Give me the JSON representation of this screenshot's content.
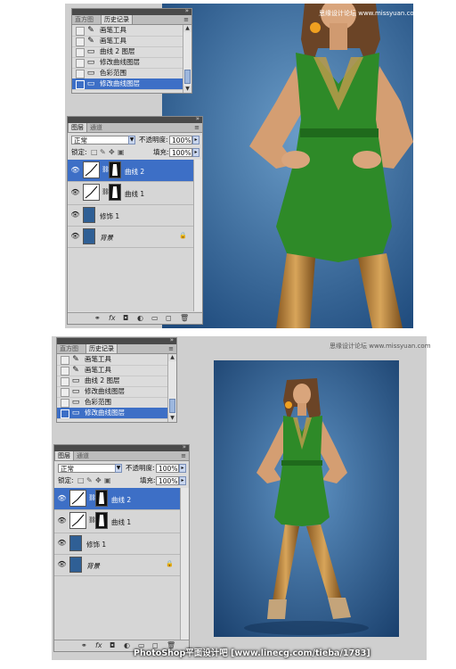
{
  "history_panel": {
    "tabs": [
      "直方图",
      "历史记录"
    ],
    "active_tab": 1,
    "items": [
      {
        "label": "画笔工具",
        "icon": "brush-icon"
      },
      {
        "label": "画笔工具",
        "icon": "brush-icon"
      },
      {
        "label": "曲线 2 图层",
        "icon": "document-icon"
      },
      {
        "label": "修改曲线图层",
        "icon": "document-icon"
      },
      {
        "label": "色彩范围",
        "icon": "document-icon"
      },
      {
        "label": "修改曲线图层",
        "icon": "document-icon",
        "selected": true
      }
    ]
  },
  "layers_panel": {
    "tabs": [
      "图层",
      "通道"
    ],
    "active_tab": 0,
    "blend_mode": "正常",
    "opacity_label": "不透明度:",
    "opacity_value": "100%",
    "lock_label": "锁定:",
    "fill_label": "填充:",
    "fill_value": "100%",
    "layers": [
      {
        "name": "曲线 2",
        "type": "adjustment",
        "selected": true
      },
      {
        "name": "曲线 1",
        "type": "adjustment"
      },
      {
        "name": "修饰 1",
        "type": "image"
      },
      {
        "name": "背景",
        "type": "image",
        "locked": true
      }
    ]
  },
  "watermark_top": "思缘设计论坛 www.missyuan.com",
  "watermark_bottom": "思缘设计论坛 www.missyuan.com",
  "footer": "PhotoShop平面设计吧 [www.linecg.com/tieba/1783]",
  "colors": {
    "selection": "#3d6fc6",
    "panel_bg": "#dcdcdc",
    "photo_bg": "#2f5f95",
    "dress": "#2e8a28",
    "legs": "#b8843a"
  }
}
